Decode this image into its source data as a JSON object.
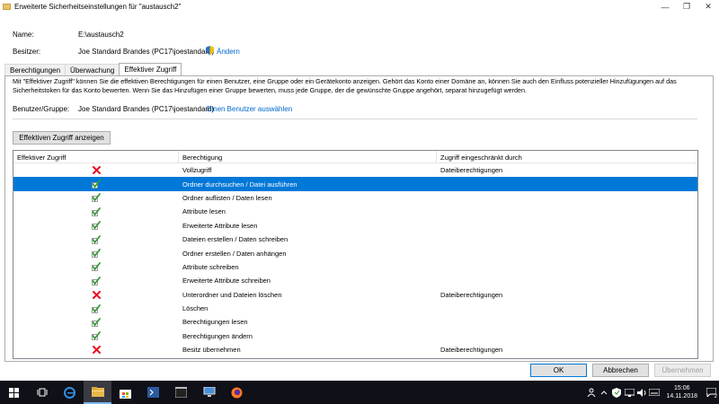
{
  "window": {
    "title": "Erweiterte Sicherheitseinstellungen für \"austausch2\"",
    "minimize_glyph": "—",
    "maximize_glyph": "❐",
    "close_glyph": "✕"
  },
  "info": {
    "name_label": "Name:",
    "name_value": "E:\\austausch2",
    "owner_label": "Besitzer:",
    "owner_value": "Joe Standard Brandes (PC17\\joestandard)",
    "change_link": "Ändern"
  },
  "tabs": [
    {
      "label": "Berechtigungen"
    },
    {
      "label": "Überwachung"
    },
    {
      "label": "Effektiver Zugriff"
    }
  ],
  "description": "Mit \"Effektiver Zugriff\" können Sie die effektiven Berechtigungen für einen Benutzer, eine Gruppe oder ein Gerätekonto anzeigen. Gehört das Konto einer Domäne an, können Sie auch den Einfluss potenzieller Hinzufügungen auf das Sicherheitstoken für das Konto bewerten. Wenn Sie das Hinzufügen einer Gruppe bewerten, muss jede Gruppe, der die gewünschte Gruppe angehört, separat hinzugefügt werden.",
  "user": {
    "label": "Benutzer/Gruppe:",
    "value": "Joe Standard Brandes (PC17\\joestandard)",
    "select_link": "Einen Benutzer auswählen"
  },
  "show_button": "Effektiven Zugriff anzeigen",
  "grid": {
    "columns": [
      "Effektiver Zugriff",
      "Berechtigung",
      "Zugriff eingeschränkt durch"
    ],
    "rows": [
      {
        "access": "denied",
        "permission": "Vollzugriff",
        "restricted": "Dateiberechtigungen"
      },
      {
        "access": "granted",
        "permission": "Ordner durchsuchen / Datei ausführen",
        "restricted": "",
        "selected": true
      },
      {
        "access": "granted",
        "permission": "Ordner auflisten / Daten lesen",
        "restricted": ""
      },
      {
        "access": "granted",
        "permission": "Attribute lesen",
        "restricted": ""
      },
      {
        "access": "granted",
        "permission": "Erweiterte Attribute lesen",
        "restricted": ""
      },
      {
        "access": "granted",
        "permission": "Dateien erstellen / Daten schreiben",
        "restricted": ""
      },
      {
        "access": "granted",
        "permission": "Ordner erstellen / Daten anhängen",
        "restricted": ""
      },
      {
        "access": "granted",
        "permission": "Attribute schreiben",
        "restricted": ""
      },
      {
        "access": "granted",
        "permission": "Erweiterte Attribute schreiben",
        "restricted": ""
      },
      {
        "access": "denied",
        "permission": "Unterordner und Dateien löschen",
        "restricted": "Dateiberechtigungen"
      },
      {
        "access": "granted",
        "permission": "Löschen",
        "restricted": ""
      },
      {
        "access": "granted",
        "permission": "Berechtigungen lesen",
        "restricted": ""
      },
      {
        "access": "granted",
        "permission": "Berechtigungen ändern",
        "restricted": ""
      },
      {
        "access": "denied",
        "permission": "Besitz übernehmen",
        "restricted": "Dateiberechtigungen"
      }
    ]
  },
  "buttons": {
    "ok": "OK",
    "cancel": "Abbrechen",
    "apply": "Übernehmen"
  },
  "taskbar": {
    "time": "15:06",
    "date": "14.11.2018",
    "notification_count": "2"
  },
  "colors": {
    "accent": "#0078d7",
    "link": "#0066cc",
    "denied": "#e81123",
    "granted": "#3a9a3a"
  }
}
